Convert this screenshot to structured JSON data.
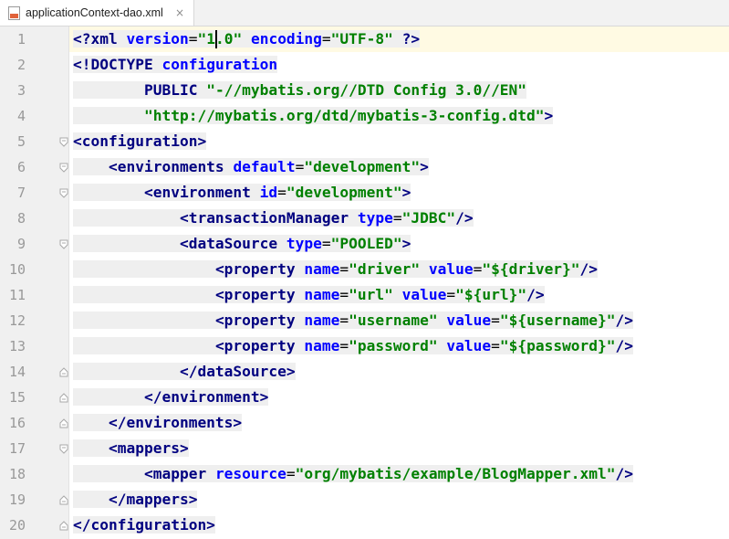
{
  "tab": {
    "filename": "applicationContext-dao.xml",
    "icon": "xml-file-icon",
    "close": "×"
  },
  "editor": {
    "lines": [
      {
        "num": "1",
        "fold": "none",
        "tokens": [
          [
            "tag",
            "<?xml "
          ],
          [
            "attr",
            "version"
          ],
          [
            "plain",
            "="
          ],
          [
            "val",
            "\"1.0\""
          ],
          [
            "plain",
            " "
          ],
          [
            "attr",
            "encoding"
          ],
          [
            "plain",
            "="
          ],
          [
            "val",
            "\"UTF-8\""
          ],
          [
            "plain",
            " "
          ],
          [
            "tag",
            "?>"
          ]
        ]
      },
      {
        "num": "2",
        "fold": "none",
        "tokens": [
          [
            "tag",
            "<!DOCTYPE "
          ],
          [
            "attr",
            "configuration"
          ]
        ]
      },
      {
        "num": "3",
        "fold": "none",
        "tokens": [
          [
            "plain",
            "        "
          ],
          [
            "tag",
            "PUBLIC "
          ],
          [
            "val",
            "\"-//mybatis.org//DTD Config 3.0//EN\""
          ]
        ]
      },
      {
        "num": "4",
        "fold": "none",
        "tokens": [
          [
            "plain",
            "        "
          ],
          [
            "val",
            "\"http://mybatis.org/dtd/mybatis-3-config.dtd\""
          ],
          [
            "tag",
            ">"
          ]
        ]
      },
      {
        "num": "5",
        "fold": "open",
        "tokens": [
          [
            "tag",
            "<configuration>"
          ]
        ]
      },
      {
        "num": "6",
        "fold": "open",
        "tokens": [
          [
            "plain",
            "    "
          ],
          [
            "tag",
            "<environments "
          ],
          [
            "attr",
            "default"
          ],
          [
            "plain",
            "="
          ],
          [
            "val",
            "\"development\""
          ],
          [
            "tag",
            ">"
          ]
        ]
      },
      {
        "num": "7",
        "fold": "open",
        "tokens": [
          [
            "plain",
            "        "
          ],
          [
            "tag",
            "<environment "
          ],
          [
            "attr",
            "id"
          ],
          [
            "plain",
            "="
          ],
          [
            "val",
            "\"development\""
          ],
          [
            "tag",
            ">"
          ]
        ]
      },
      {
        "num": "8",
        "fold": "none",
        "tokens": [
          [
            "plain",
            "            "
          ],
          [
            "tag",
            "<transactionManager "
          ],
          [
            "attr",
            "type"
          ],
          [
            "plain",
            "="
          ],
          [
            "val",
            "\"JDBC\""
          ],
          [
            "tag",
            "/>"
          ]
        ]
      },
      {
        "num": "9",
        "fold": "open",
        "tokens": [
          [
            "plain",
            "            "
          ],
          [
            "tag",
            "<dataSource "
          ],
          [
            "attr",
            "type"
          ],
          [
            "plain",
            "="
          ],
          [
            "val",
            "\"POOLED\""
          ],
          [
            "tag",
            ">"
          ]
        ]
      },
      {
        "num": "10",
        "fold": "none",
        "tokens": [
          [
            "plain",
            "                "
          ],
          [
            "tag",
            "<property "
          ],
          [
            "attr",
            "name"
          ],
          [
            "plain",
            "="
          ],
          [
            "val",
            "\"driver\""
          ],
          [
            "plain",
            " "
          ],
          [
            "attr",
            "value"
          ],
          [
            "plain",
            "="
          ],
          [
            "val",
            "\"${driver}\""
          ],
          [
            "tag",
            "/>"
          ]
        ]
      },
      {
        "num": "11",
        "fold": "none",
        "tokens": [
          [
            "plain",
            "                "
          ],
          [
            "tag",
            "<property "
          ],
          [
            "attr",
            "name"
          ],
          [
            "plain",
            "="
          ],
          [
            "val",
            "\"url\""
          ],
          [
            "plain",
            " "
          ],
          [
            "attr",
            "value"
          ],
          [
            "plain",
            "="
          ],
          [
            "val",
            "\"${url}\""
          ],
          [
            "tag",
            "/>"
          ]
        ]
      },
      {
        "num": "12",
        "fold": "none",
        "tokens": [
          [
            "plain",
            "                "
          ],
          [
            "tag",
            "<property "
          ],
          [
            "attr",
            "name"
          ],
          [
            "plain",
            "="
          ],
          [
            "val",
            "\"username\""
          ],
          [
            "plain",
            " "
          ],
          [
            "attr",
            "value"
          ],
          [
            "plain",
            "="
          ],
          [
            "val",
            "\"${username}\""
          ],
          [
            "tag",
            "/>"
          ]
        ]
      },
      {
        "num": "13",
        "fold": "none",
        "tokens": [
          [
            "plain",
            "                "
          ],
          [
            "tag",
            "<property "
          ],
          [
            "attr",
            "name"
          ],
          [
            "plain",
            "="
          ],
          [
            "val",
            "\"password\""
          ],
          [
            "plain",
            " "
          ],
          [
            "attr",
            "value"
          ],
          [
            "plain",
            "="
          ],
          [
            "val",
            "\"${password}\""
          ],
          [
            "tag",
            "/>"
          ]
        ]
      },
      {
        "num": "14",
        "fold": "close",
        "tokens": [
          [
            "plain",
            "            "
          ],
          [
            "tag",
            "</dataSource>"
          ]
        ]
      },
      {
        "num": "15",
        "fold": "close",
        "tokens": [
          [
            "plain",
            "        "
          ],
          [
            "tag",
            "</environment>"
          ]
        ]
      },
      {
        "num": "16",
        "fold": "close",
        "tokens": [
          [
            "plain",
            "    "
          ],
          [
            "tag",
            "</environments>"
          ]
        ]
      },
      {
        "num": "17",
        "fold": "open",
        "tokens": [
          [
            "plain",
            "    "
          ],
          [
            "tag",
            "<mappers>"
          ]
        ]
      },
      {
        "num": "18",
        "fold": "none",
        "tokens": [
          [
            "plain",
            "        "
          ],
          [
            "tag",
            "<mapper "
          ],
          [
            "attr",
            "resource"
          ],
          [
            "plain",
            "="
          ],
          [
            "val",
            "\"org/mybatis/example/BlogMapper.xml\""
          ],
          [
            "tag",
            "/>"
          ]
        ]
      },
      {
        "num": "19",
        "fold": "close",
        "tokens": [
          [
            "plain",
            "    "
          ],
          [
            "tag",
            "</mappers>"
          ]
        ]
      },
      {
        "num": "20",
        "fold": "close",
        "tokens": [
          [
            "tag",
            "</configuration>"
          ]
        ]
      }
    ],
    "caret": {
      "line": 1,
      "column": 16
    },
    "colors": {
      "tag": "#000080",
      "attr": "#0000ff",
      "val": "#008000",
      "current_line": "#fffae3",
      "gutter": "#f0f0f0"
    }
  }
}
